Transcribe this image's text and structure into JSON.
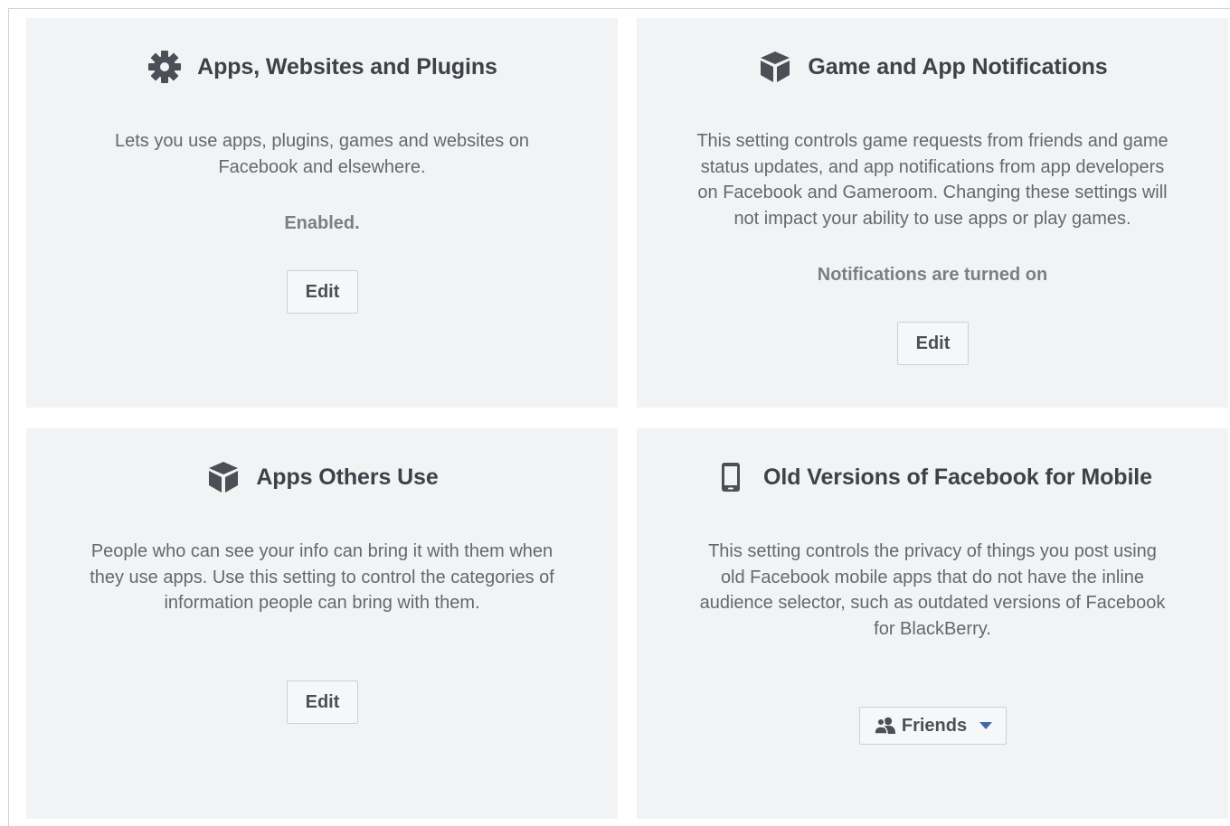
{
  "cards": {
    "apps_websites_plugins": {
      "icon": "gear-icon",
      "title": "Apps, Websites and Plugins",
      "description_lines": [
        "Lets you use apps, plugins, games and websites on",
        "Facebook and elsewhere."
      ],
      "status": "Enabled.",
      "button_label": "Edit"
    },
    "game_app_notifications": {
      "icon": "cube-icon",
      "title": "Game and App Notifications",
      "description_lines": [
        "This setting controls game requests from friends and game",
        "status updates, and app notifications from app developers",
        "on Facebook and Gameroom. Changing these settings will",
        "not impact your ability to use apps or play games."
      ],
      "status": "Notifications are turned on",
      "button_label": "Edit"
    },
    "apps_others_use": {
      "icon": "cube-icon",
      "title": "Apps Others Use",
      "description_lines": [
        "People who can see your info can bring it with them when",
        "they use apps. Use this setting to control the categories of",
        "information people can bring with them."
      ],
      "button_label": "Edit"
    },
    "old_versions_mobile": {
      "icon": "mobile-phone-icon",
      "title": "Old Versions of Facebook for Mobile",
      "description_lines": [
        "This setting controls the privacy of things you post using",
        "old Facebook mobile apps that do not have the inline",
        "audience selector, such as outdated versions of Facebook",
        "for BlackBerry."
      ],
      "audience_selector": {
        "icon": "friends-icon",
        "label": "Friends",
        "caret_icon": "caret-down-icon"
      }
    }
  },
  "colors": {
    "card_background": "#f2f3f5",
    "title_text": "#3d4148",
    "body_text": "#646870",
    "status_text": "#7a7e85",
    "icon": "#4b4f56",
    "caret": "#4267b2"
  }
}
